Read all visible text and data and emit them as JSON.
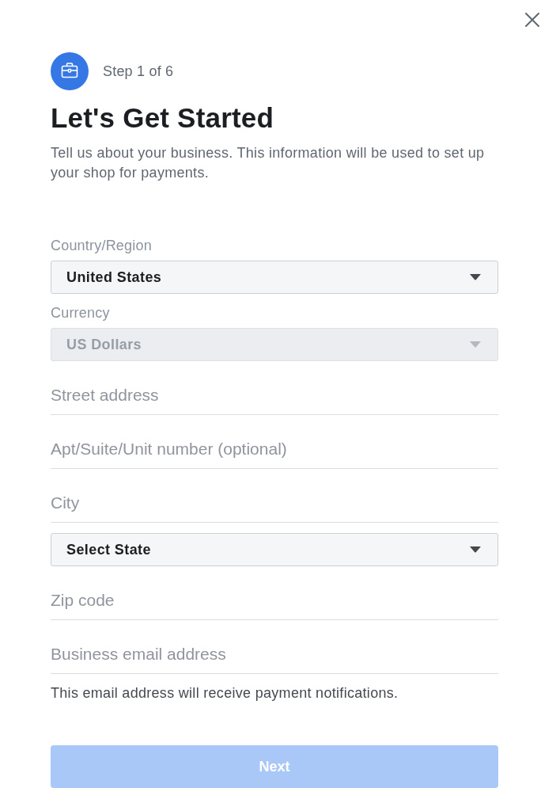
{
  "step": {
    "label": "Step 1 of 6"
  },
  "heading": "Let's Get Started",
  "description": "Tell us about your business. This information will be used to set up your shop for payments.",
  "fields": [
    {
      "kind": "select",
      "label": "Country/Region",
      "value": "United States",
      "disabled": false
    },
    {
      "kind": "select",
      "label": "Currency",
      "value": "US Dollars",
      "disabled": true
    },
    {
      "kind": "text",
      "placeholder": "Street address"
    },
    {
      "kind": "text",
      "placeholder": "Apt/Suite/Unit number (optional)"
    },
    {
      "kind": "text",
      "placeholder": "City"
    },
    {
      "kind": "select",
      "value": "Select State",
      "disabled": false
    },
    {
      "kind": "text",
      "placeholder": "Zip code"
    },
    {
      "kind": "text",
      "placeholder": "Business email address"
    }
  ],
  "help_text": "This email address will receive payment notifications.",
  "next_button": {
    "label": "Next",
    "disabled": true
  }
}
